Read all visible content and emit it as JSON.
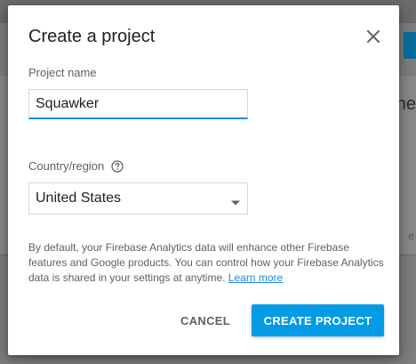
{
  "background": {
    "partial_heading": "ne",
    "partial_text": "e"
  },
  "dialog": {
    "title": "Create a project",
    "close_icon": "close-icon",
    "project_name": {
      "label": "Project name",
      "value": "Squawker"
    },
    "country": {
      "label": "Country/region",
      "help_icon": "help-circle-icon",
      "selected": "United States",
      "caret_icon": "dropdown-caret-icon"
    },
    "info": {
      "text": "By default, your Firebase Analytics data will enhance other Firebase features and Google products. You can control how your Firebase Analytics data is shared in your settings at anytime.",
      "link": "Learn more"
    },
    "buttons": {
      "cancel": "CANCEL",
      "create": "CREATE PROJECT"
    }
  },
  "colors": {
    "accent": "#039be5",
    "link": "#1e88e5",
    "input_underline": "#1e88e5"
  }
}
